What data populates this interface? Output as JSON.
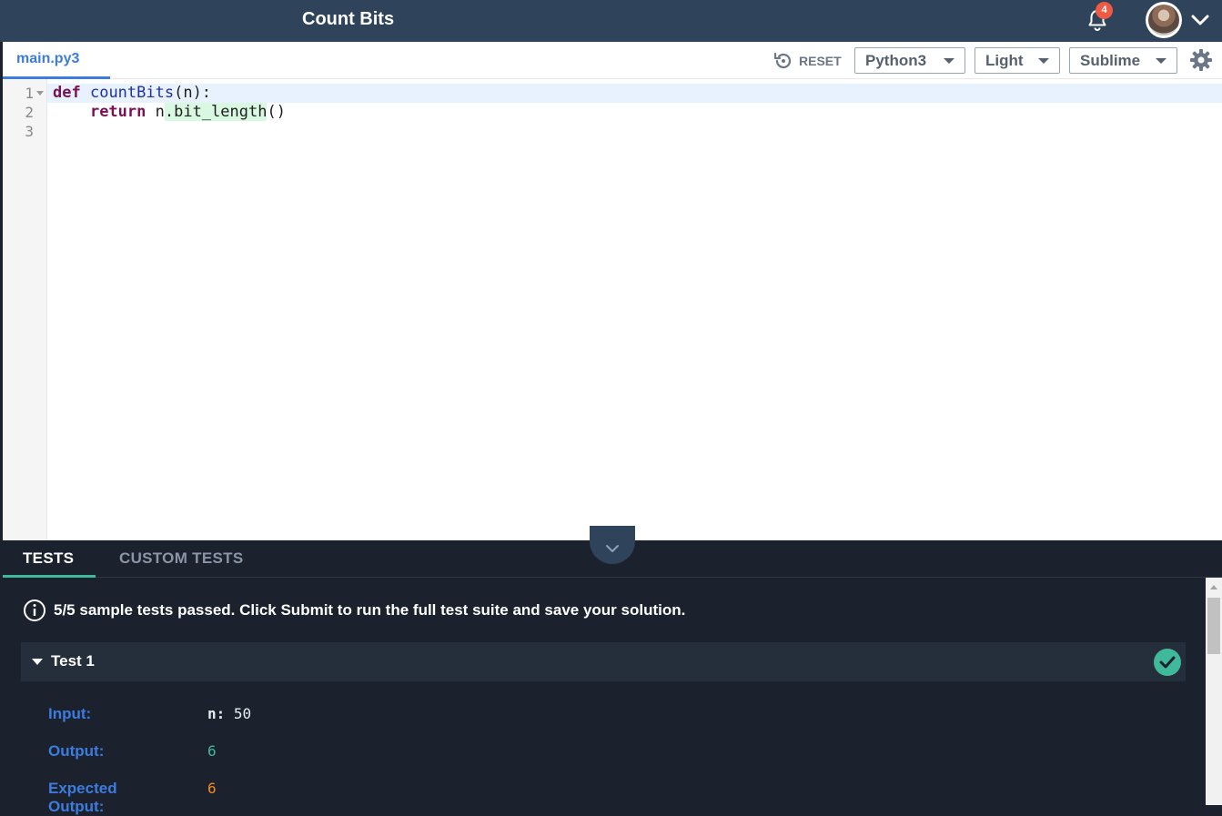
{
  "header": {
    "title": "Count Bits",
    "notification_count": "4"
  },
  "editor": {
    "file_tab": "main.py3",
    "reset_label": "RESET",
    "language": "Python3",
    "theme": "Light",
    "keymap": "Sublime",
    "line_numbers": [
      "1",
      "2",
      "3"
    ],
    "code": {
      "line1": {
        "kw": "def",
        "fn": "countBits",
        "rest": "(n):"
      },
      "line2": {
        "indent": "    ",
        "kw": "return",
        "pre": " n",
        "hl": ".bit_length",
        "post": "()"
      }
    }
  },
  "panel": {
    "tabs": [
      "TESTS",
      "CUSTOM TESTS"
    ],
    "summary_count": "5/5",
    "summary_text": " sample tests passed. Click Submit to run the full test suite and save your solution.",
    "test": {
      "name": "Test 1",
      "input_label": "Input:",
      "input_var": "n:",
      "input_value": " 50",
      "output_label": "Output:",
      "output_value": "6",
      "expected_label": "Expected Output:",
      "expected_value": "6"
    }
  },
  "colors": {
    "topbar": "#2f435b",
    "accent_blue": "#3c7cde",
    "success_green": "#3fb99a",
    "badge_red": "#ef5a44",
    "expected_orange": "#f08a24"
  }
}
